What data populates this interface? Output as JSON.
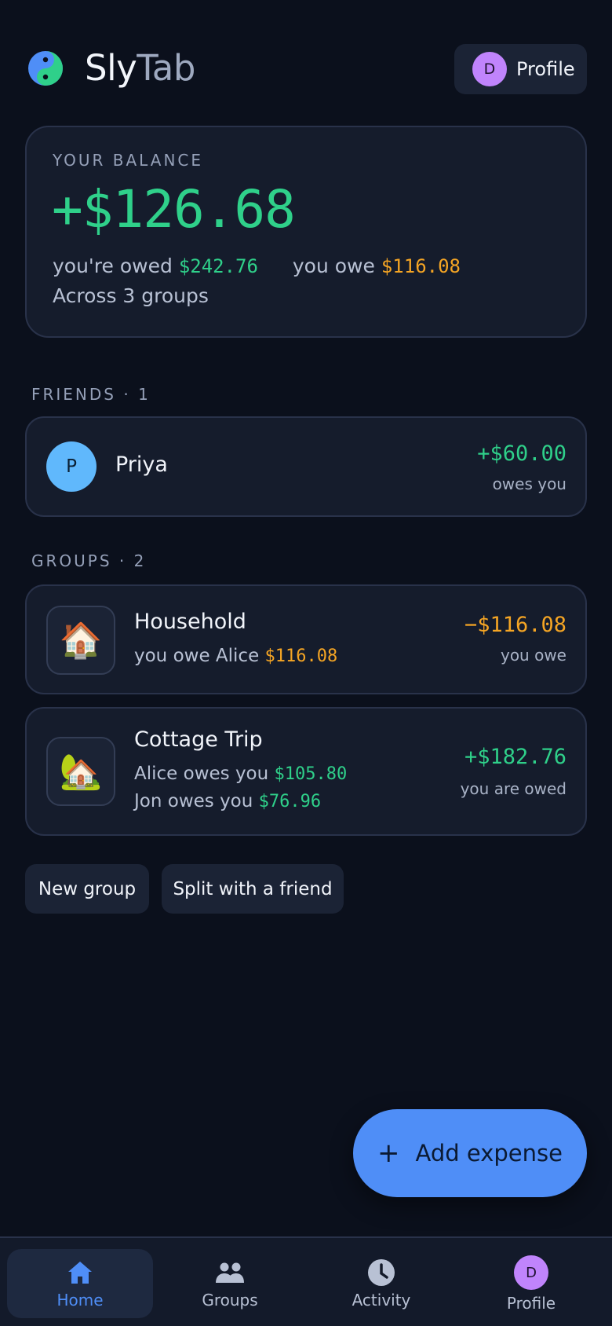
{
  "header": {
    "brand_part1": "Sly",
    "brand_part2": "Tab",
    "profile_initial": "D",
    "profile_label": "Profile"
  },
  "balance": {
    "label": "YOUR BALANCE",
    "amount": "+$126.68",
    "owed_prefix": "you're owed",
    "owed_amount": "$242.76",
    "owe_prefix": "you owe",
    "owe_amount": "$116.08",
    "groups_text": "Across 3 groups"
  },
  "friends": {
    "title": "FRIENDS · 1",
    "items": [
      {
        "initial": "P",
        "name": "Priya",
        "amount": "+$60.00",
        "status": "owes you"
      }
    ]
  },
  "groups": {
    "title": "GROUPS · 2",
    "items": [
      {
        "emoji": "🏠",
        "name": "Household",
        "lines": [
          {
            "text": "you owe Alice",
            "amount": "$116.08"
          }
        ],
        "amount": "−$116.08",
        "status": "you owe"
      },
      {
        "emoji": "🏡",
        "name": "Cottage Trip",
        "lines": [
          {
            "text": "Alice owes you",
            "amount": "$105.80"
          },
          {
            "text": "Jon owes you",
            "amount": "$76.96"
          }
        ],
        "amount": "+$182.76",
        "status": "you are owed"
      }
    ]
  },
  "actions": {
    "new_group": "New group",
    "split_friend": "Split with a friend"
  },
  "fab": {
    "icon": "plus-icon",
    "plus": "+",
    "label": "Add expense"
  },
  "nav": {
    "items": [
      {
        "label": "Home",
        "icon": "home-icon",
        "active": true
      },
      {
        "label": "Groups",
        "icon": "people-icon",
        "active": false
      },
      {
        "label": "Activity",
        "icon": "clock-icon",
        "active": false
      },
      {
        "label": "Profile",
        "icon": "avatar",
        "initial": "D",
        "active": false
      }
    ]
  },
  "colors": {
    "background": "#0b101c",
    "card": "#151c2c",
    "positive": "#2fd08a",
    "negative": "#f5a524",
    "accent": "#4f8ef7",
    "avatar_profile": "#c084fc",
    "avatar_friend": "#60b8fc"
  }
}
